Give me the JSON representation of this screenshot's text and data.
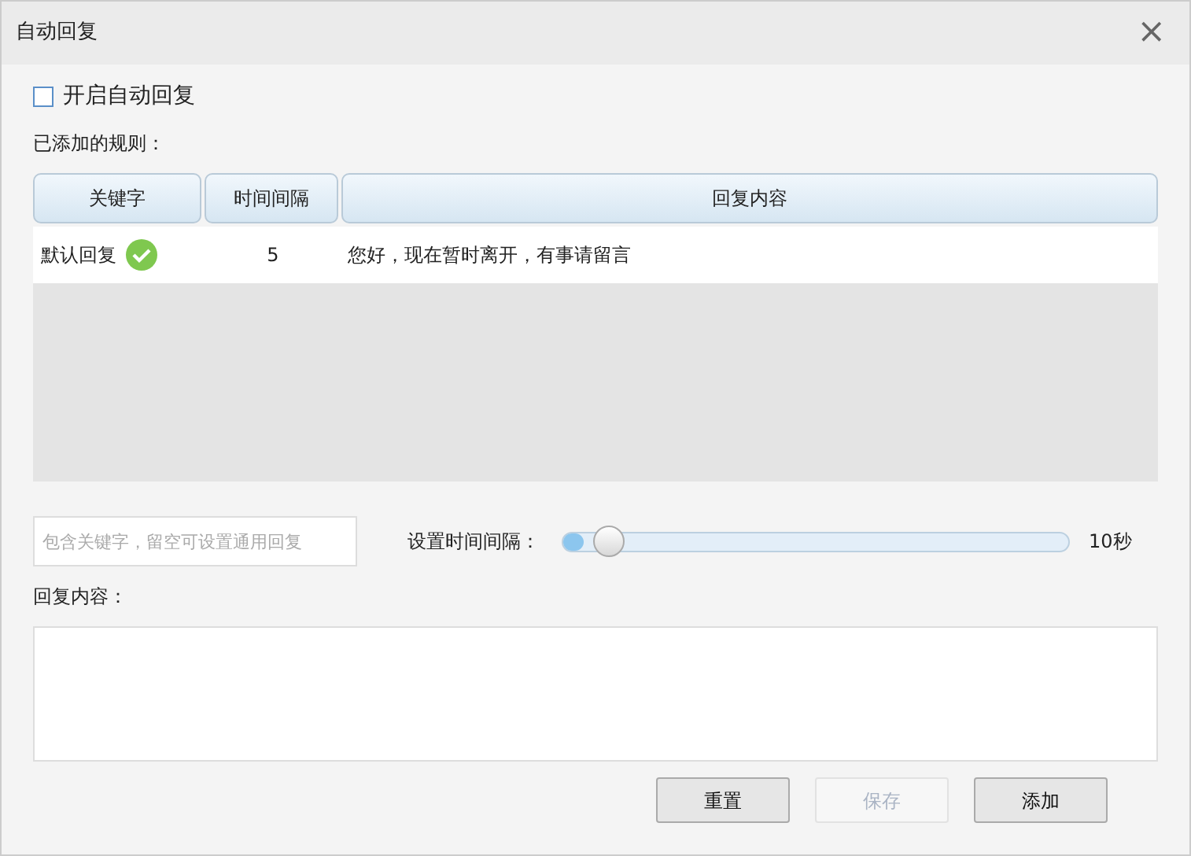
{
  "window": {
    "title": "自动回复",
    "close": "×"
  },
  "auto_reply": {
    "label": "开启自动回复",
    "checked": false
  },
  "rules_label": "已添加的规则：",
  "table": {
    "columns": [
      "关键字",
      "时间间隔",
      "回复内容"
    ],
    "rows": [
      {
        "keyword": "默认回复",
        "enabled": true,
        "interval": "5",
        "content": "您好，现在暂时离开，有事请留言"
      }
    ]
  },
  "keyword_field": {
    "placeholder": "包含关键字，留空可设置通用回复"
  },
  "interval": {
    "label": "设置时间间隔：",
    "level": 0.04,
    "reading": "10秒"
  },
  "content_label": "回复内容：",
  "buttons": [
    {
      "label": "重置",
      "disabled": false
    },
    {
      "label": "保存",
      "disabled": true
    },
    {
      "label": "添加",
      "disabled": false
    }
  ]
}
